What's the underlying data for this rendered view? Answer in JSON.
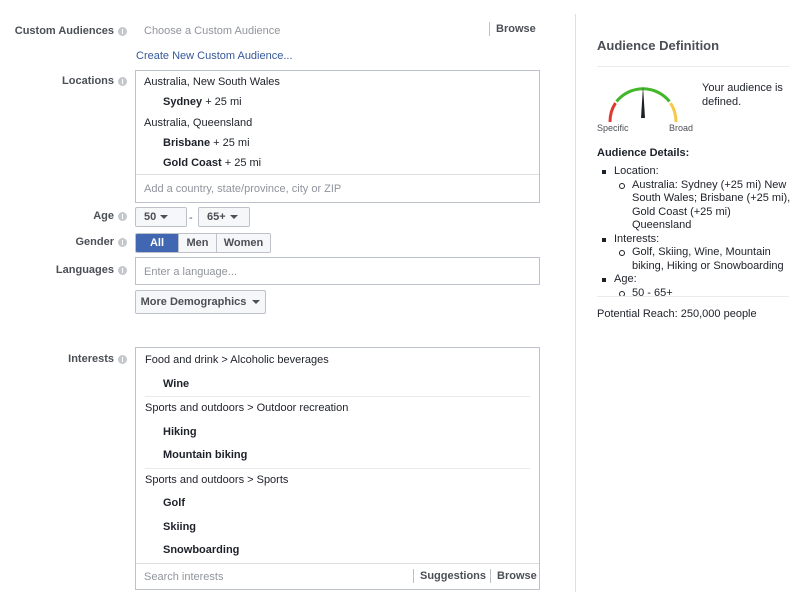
{
  "custom_audiences": {
    "label": "Custom Audiences",
    "placeholder": "Choose a Custom Audience",
    "browse": "Browse",
    "create_link": "Create New Custom Audience..."
  },
  "locations": {
    "label": "Locations",
    "entries": [
      {
        "region": "Australia, New South Wales",
        "cities": [
          {
            "name": "Sydney",
            "radius": "+ 25 mi"
          }
        ]
      },
      {
        "region": "Australia, Queensland",
        "cities": [
          {
            "name": "Brisbane",
            "radius": "+ 25 mi"
          },
          {
            "name": "Gold Coast",
            "radius": "+ 25 mi"
          }
        ]
      }
    ],
    "placeholder": "Add a country, state/province, city or ZIP"
  },
  "age": {
    "label": "Age",
    "min": "50",
    "separator": "-",
    "max": "65+"
  },
  "gender": {
    "label": "Gender",
    "options": [
      "All",
      "Men",
      "Women"
    ],
    "selected": "All"
  },
  "languages": {
    "label": "Languages",
    "placeholder": "Enter a language..."
  },
  "more_demographics": {
    "label": "More Demographics"
  },
  "interests": {
    "label": "Interests",
    "groups": [
      {
        "category": "Food and drink > Alcoholic beverages",
        "items": [
          "Wine"
        ]
      },
      {
        "category": "Sports and outdoors > Outdoor recreation",
        "items": [
          "Hiking",
          "Mountain biking"
        ]
      },
      {
        "category": "Sports and outdoors > Sports",
        "items": [
          "Golf",
          "Skiing",
          "Snowboarding"
        ]
      }
    ],
    "search_placeholder": "Search interests",
    "suggestions": "Suggestions",
    "browse": "Browse"
  },
  "audience_definition": {
    "title": "Audience Definition",
    "gauge_left": "Specific",
    "gauge_right": "Broad",
    "status": "Your audience is defined.",
    "details_title": "Audience Details:",
    "details": {
      "location_label": "Location:",
      "location_value": "Australia: Sydney (+25 mi) New South Wales; Brisbane (+25 mi), Gold Coast (+25 mi) Queensland",
      "interests_label": "Interests:",
      "interests_value": "Golf, Skiing, Wine, Mountain biking, Hiking or Snowboarding",
      "age_label": "Age:",
      "age_value": "50 - 65+"
    },
    "potential_reach": "Potential Reach: 250,000 people"
  },
  "colors": {
    "accent": "#4267b2",
    "link": "#365899",
    "gauge_red": "#e03a2f",
    "gauge_green": "#42b72a",
    "gauge_yellow": "#f7c94b"
  }
}
